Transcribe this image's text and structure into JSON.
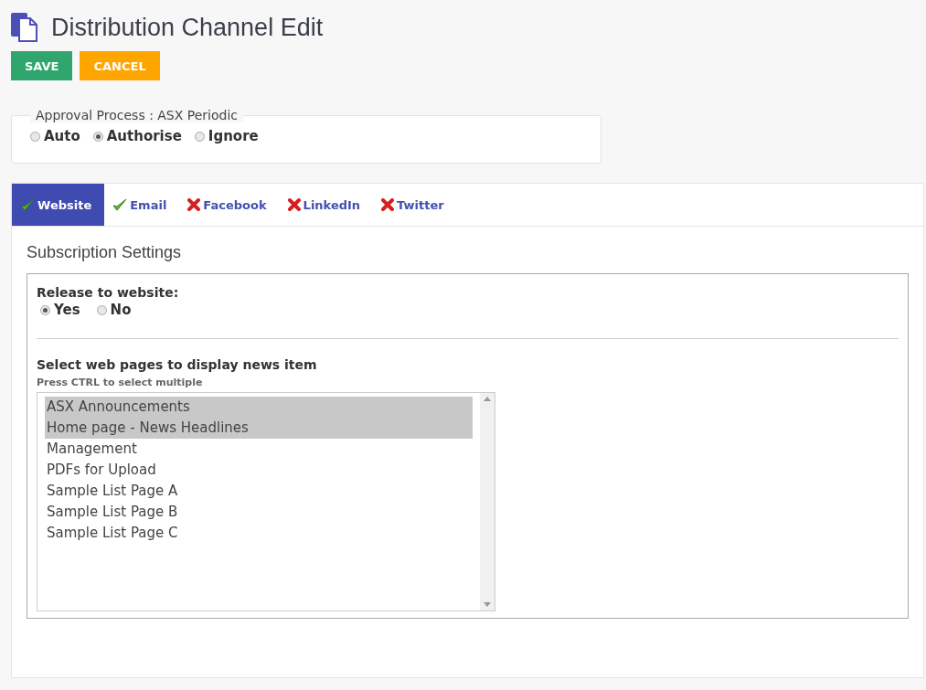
{
  "page": {
    "title": "Distribution Channel Edit"
  },
  "actions": [
    {
      "label": "SAVE",
      "kind": "save"
    },
    {
      "label": "CANCEL",
      "kind": "cancel"
    }
  ],
  "approval": {
    "legend": "Approval Process : ASX Periodic",
    "options": [
      {
        "label": "Auto",
        "selected": false
      },
      {
        "label": "Authorise",
        "selected": true
      },
      {
        "label": "Ignore",
        "selected": false
      }
    ]
  },
  "tabs": [
    {
      "label": "Website",
      "enabled": true,
      "selected": true
    },
    {
      "label": "Email",
      "enabled": true,
      "selected": false
    },
    {
      "label": "Facebook",
      "enabled": false,
      "selected": false
    },
    {
      "label": "LinkedIn",
      "enabled": false,
      "selected": false
    },
    {
      "label": "Twitter",
      "enabled": false,
      "selected": false
    }
  ],
  "panel": {
    "heading": "Subscription Settings",
    "release": {
      "label": "Release to website:",
      "options": [
        {
          "label": "Yes",
          "selected": true
        },
        {
          "label": "No",
          "selected": false
        }
      ]
    },
    "pages": {
      "label": "Select web pages to display news item",
      "hint": "Press CTRL to select multiple",
      "items": [
        {
          "label": "ASX Announcements",
          "selected": true
        },
        {
          "label": "Home page - News Headlines",
          "selected": true
        },
        {
          "label": "Management",
          "selected": false
        },
        {
          "label": "PDFs for Upload",
          "selected": false
        },
        {
          "label": "Sample List Page A",
          "selected": false
        },
        {
          "label": "Sample List Page B",
          "selected": false
        },
        {
          "label": "Sample List Page C",
          "selected": false
        }
      ]
    }
  }
}
